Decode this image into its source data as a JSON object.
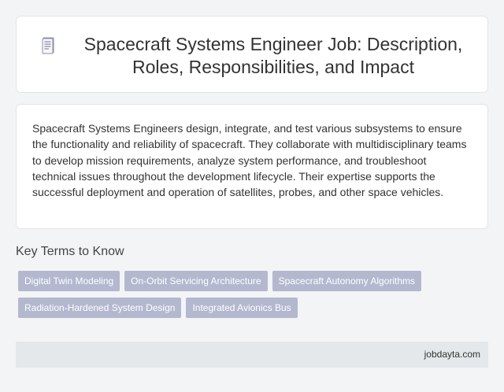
{
  "header": {
    "icon": "document-icon",
    "title": "Spacecraft Systems Engineer Job: Description, Roles, Responsibilities, and Impact"
  },
  "description": "Spacecraft Systems Engineers design, integrate, and test various subsystems to ensure the functionality and reliability of spacecraft. They collaborate with multidisciplinary teams to develop mission requirements, analyze system performance, and troubleshoot technical issues throughout the development lifecycle. Their expertise supports the successful deployment and operation of satellites, probes, and other space vehicles.",
  "key_terms": {
    "heading": "Key Terms to Know",
    "tags": [
      "Digital Twin Modeling",
      "On-Orbit Servicing Architecture",
      "Spacecraft Autonomy Algorithms",
      "Radiation-Hardened System Design",
      "Integrated Avionics Bus"
    ]
  },
  "footer": {
    "site": "jobdayta.com"
  },
  "colors": {
    "page_background": "#f3f4f6",
    "card_background": "#ffffff",
    "tag_background": "#b3b8cf",
    "tag_text": "#ffffff",
    "footer_background": "#e4e8ea"
  }
}
